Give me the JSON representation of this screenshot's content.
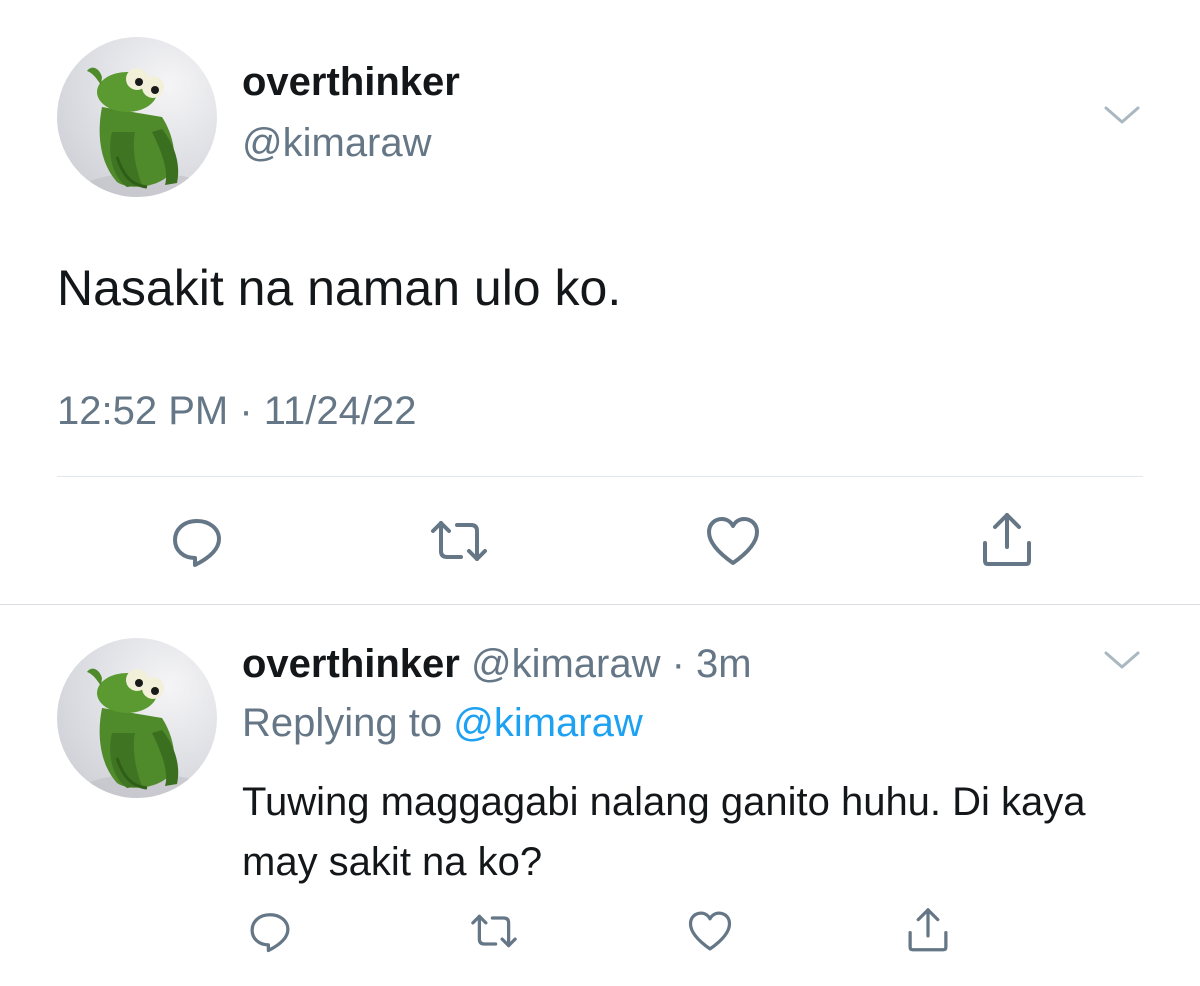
{
  "main_tweet": {
    "display_name": "overthinker",
    "handle": "@kimaraw",
    "text": "Nasakit na naman ulo ko.",
    "timestamp": "12:52 PM · 11/24/22",
    "avatar_icon": "kermit-avatar",
    "actions": [
      "reply-icon",
      "retweet-icon",
      "like-icon",
      "share-icon"
    ]
  },
  "reply_tweet": {
    "display_name": "overthinker",
    "handle": "@kimaraw",
    "separator": " · ",
    "age": "3m",
    "replying_prefix": "Replying to ",
    "replying_to": "@kimaraw",
    "text": "Tuwing maggagabi nalang ganito huhu. Di kaya may sakit na ko?",
    "avatar_icon": "kermit-avatar",
    "actions": [
      "reply-icon",
      "retweet-icon",
      "like-icon",
      "share-icon"
    ]
  },
  "colors": {
    "text": "#14171a",
    "secondary": "#657786",
    "link": "#1da1f2",
    "divider": "#e1e8ed",
    "icon": "#657786"
  }
}
